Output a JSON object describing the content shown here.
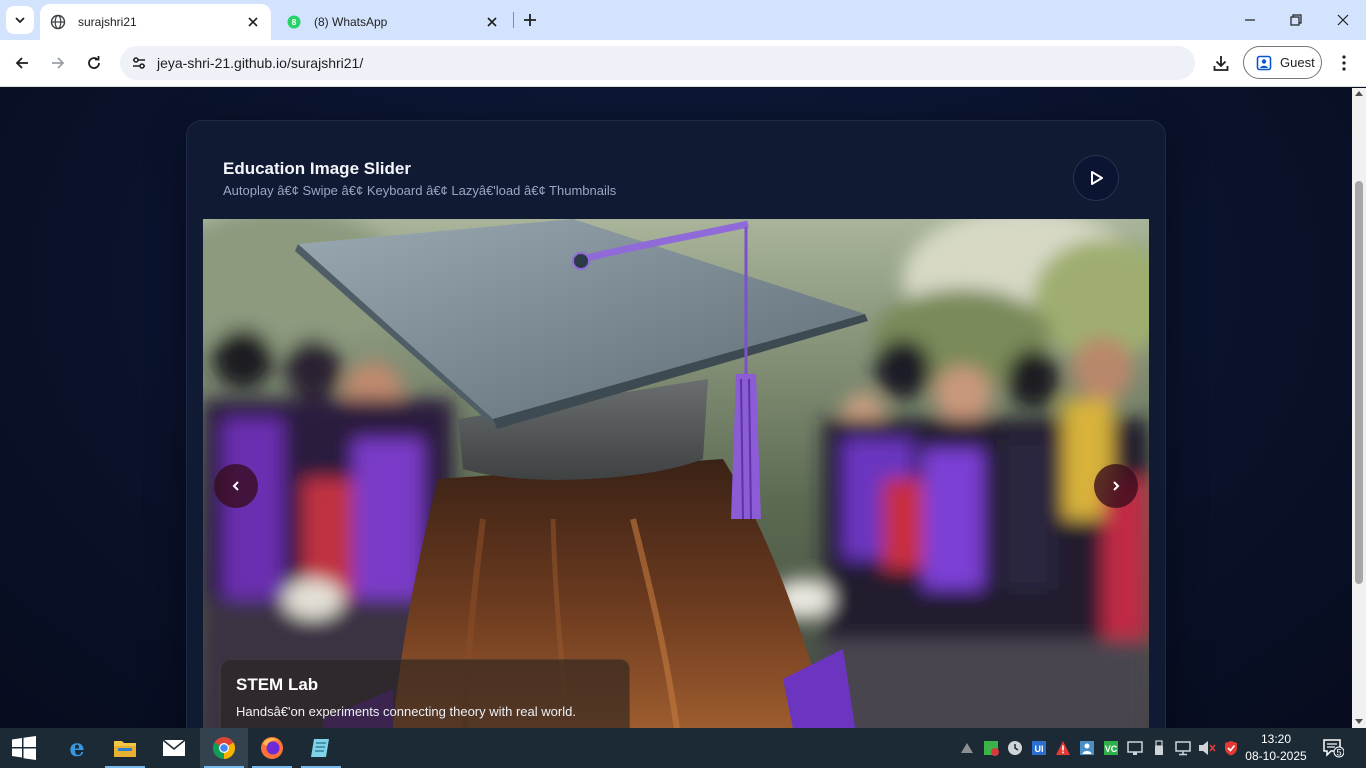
{
  "browser": {
    "tabs": [
      {
        "title": "surajshri21",
        "active": true
      },
      {
        "title": "(8) WhatsApp",
        "active": false
      }
    ],
    "url": "jeya-shri-21.github.io/surajshri21/",
    "profile_label": "Guest"
  },
  "page": {
    "card_title": "Education Image Slider",
    "card_subtitle": "Autoplay â€¢ Swipe â€¢ Keyboard â€¢ Lazyâ€'load â€¢ Thumbnails",
    "slide": {
      "caption_title": "STEM Lab",
      "caption_text": "Handsâ€'on experiments connecting theory with real world."
    }
  },
  "taskbar": {
    "apps": [
      "start-icon",
      "edge-icon",
      "file-explorer-icon",
      "mail-icon",
      "chrome-icon",
      "firefox-icon",
      "notepad-icon"
    ],
    "time": "13:20",
    "date": "08-10-2025",
    "notification_count": "5"
  },
  "colors": {
    "page_bg": "#0b1226",
    "card_bg": "#111a33",
    "tab_strip": "#d3e3fd",
    "taskbar": "#1c2a36"
  }
}
